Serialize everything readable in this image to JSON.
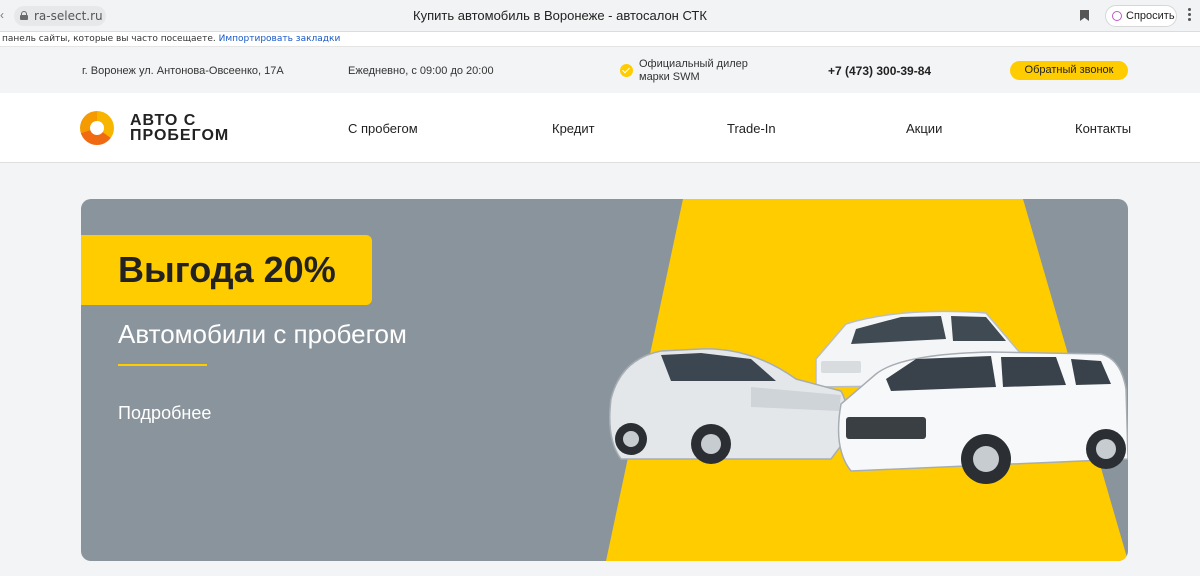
{
  "browser": {
    "url": "ra-select.ru",
    "page_title": "Купить автомобиль в Воронеже - автосалон СТК",
    "ask_label": "Спросить",
    "bookmarks_text": "панель сайты, которые вы часто посещаете.",
    "bookmarks_link": "Импортировать закладки"
  },
  "info": {
    "address": "г. Воронеж ул. Антонова-Овсеенко, 17А",
    "hours": "Ежедневно, с 09:00 до 20:00",
    "dealer_line1": "Официальный дилер",
    "dealer_line2": "марки SWM",
    "phone": "+7 (473) 300-39-84",
    "callback": "Обратный звонок"
  },
  "logo": {
    "line1": "АВТО С",
    "line2": "ПРОБЕГОМ"
  },
  "nav": {
    "items": [
      "С пробегом",
      "Кредит",
      "Trade-In",
      "Акции",
      "Контакты"
    ]
  },
  "banner": {
    "badge": "Выгода 20%",
    "title": "Автомобили с пробегом",
    "more": "Подробнее"
  },
  "colors": {
    "accent": "#ffcc00",
    "banner_bg": "#8a949c",
    "logo_orange": "#ef6a10"
  }
}
